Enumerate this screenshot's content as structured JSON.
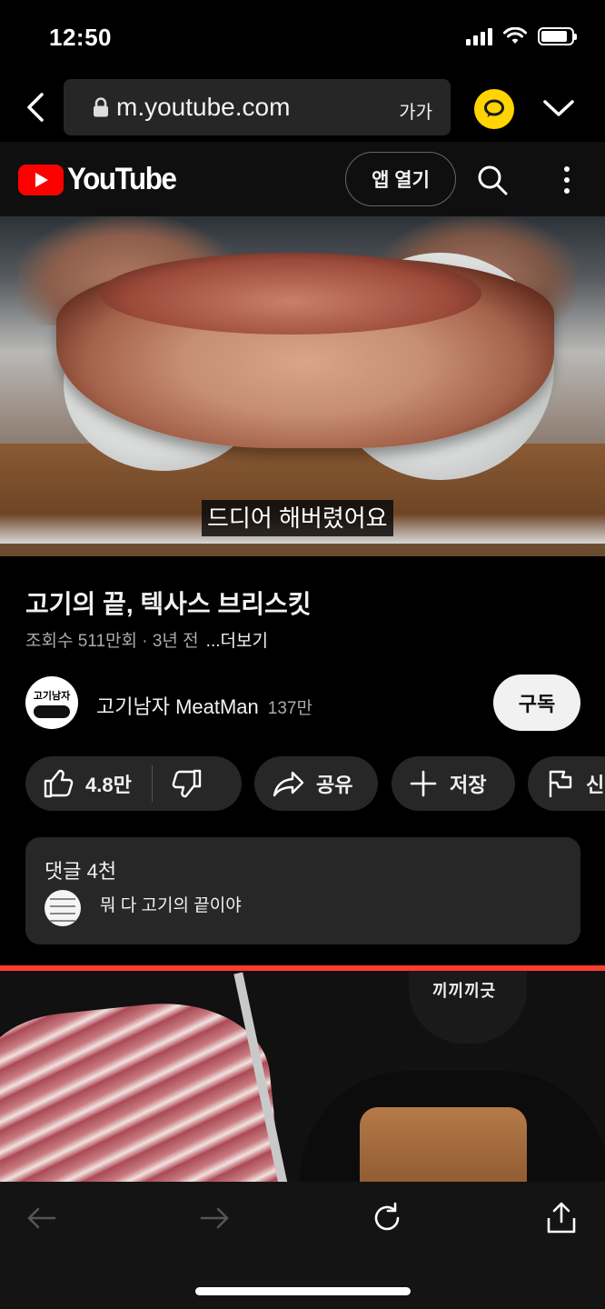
{
  "status_bar": {
    "time": "12:50"
  },
  "browser": {
    "url": "m.youtube.com",
    "text_size_label": "가가"
  },
  "header": {
    "logo_text": "YouTube",
    "open_app_label": "앱 열기"
  },
  "video": {
    "subtitle": "드디어 해버렸어요",
    "title": "고기의 끝, 텍사스 브리스킷",
    "meta": "조회수 511만회 · 3년 전",
    "more_label": "...더보기"
  },
  "channel": {
    "avatar_text": "고기남자",
    "name": "고기남자 MeatMan",
    "subscribers": "137만",
    "subscribe_label": "구독"
  },
  "actions": {
    "like_count": "4.8만",
    "share_label": "공유",
    "save_label": "저장",
    "report_label": "신"
  },
  "comments": {
    "header": "댓글 4천",
    "top_comment": "뭐 다 고기의 끝이야"
  },
  "next_video": {
    "mask_text": "끼끼끼긋"
  },
  "colors": {
    "yt_red": "#ff0000",
    "talk_yellow": "#ffd400",
    "background": "#0f0f0f",
    "progress_red": "#ff3b30"
  },
  "icons": [
    "back-icon",
    "lock-icon",
    "talk-icon",
    "chevron-down-icon",
    "search-icon",
    "more-vert-icon",
    "thumbs-up-icon",
    "thumbs-down-icon",
    "share-icon",
    "plus-icon",
    "flag-icon",
    "arrow-left-icon",
    "arrow-right-icon",
    "reload-icon",
    "share-out-icon"
  ]
}
